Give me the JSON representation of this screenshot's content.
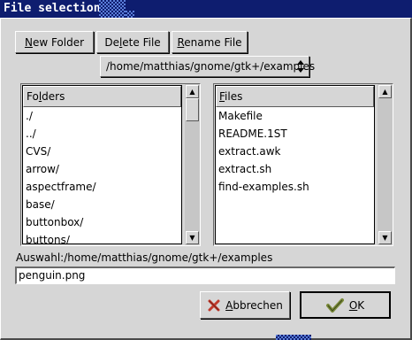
{
  "window": {
    "title": "File selection"
  },
  "toolbar": {
    "new_folder": {
      "mnemonic": "N",
      "rest": "ew Folder"
    },
    "delete_file": {
      "before": "De",
      "mnemonic": "l",
      "after": "ete File"
    },
    "rename_file": {
      "mnemonic": "R",
      "rest": "ename File"
    }
  },
  "path_select": {
    "value": "/home/matthias/gnome/gtk+/examples"
  },
  "folders": {
    "header": {
      "before": "Fo",
      "mnemonic": "l",
      "after": "ders"
    },
    "items": [
      "./",
      "../",
      "CVS/",
      "arrow/",
      "aspectframe/",
      "base/",
      "buttonbox/",
      "buttons/"
    ],
    "scroll_position": 0.0
  },
  "files": {
    "header": {
      "mnemonic": "F",
      "rest": "iles"
    },
    "items": [
      "Makefile",
      "README.1ST",
      "extract.awk",
      "extract.sh",
      "find-examples.sh"
    ]
  },
  "selection": {
    "label": "Auswahl:/home/matthias/gnome/gtk+/examples",
    "value": "penguin.png"
  },
  "buttons": {
    "cancel": {
      "mnemonic": "A",
      "rest": "bbrechen",
      "icon": "cancel-x-icon"
    },
    "ok": {
      "mnemonic": "O",
      "rest": "K",
      "icon": "ok-checkmark-icon"
    }
  },
  "colors": {
    "titlebar": "#0e1d6f",
    "window_bg": "#d6d6d6",
    "cancel_icon": "#c0392b",
    "ok_icon": "#7a8a3a"
  }
}
